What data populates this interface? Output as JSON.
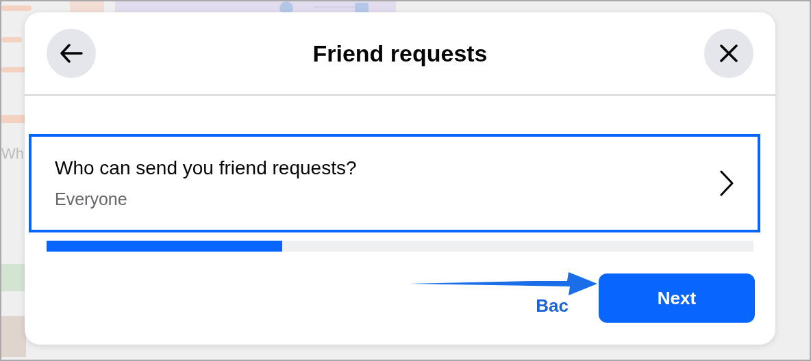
{
  "background": {
    "partial_text": "Wh"
  },
  "dialog": {
    "title": "Friend requests",
    "option": {
      "title": "Who can send you friend requests?",
      "value": "Everyone",
      "selected": true
    },
    "progress": {
      "level": 0.333
    },
    "buttons": [
      {
        "kind": "link",
        "label": "Bac"
      },
      {
        "kind": "primary",
        "label": "Next"
      }
    ],
    "annotation": {
      "kind": "arrow"
    }
  }
}
